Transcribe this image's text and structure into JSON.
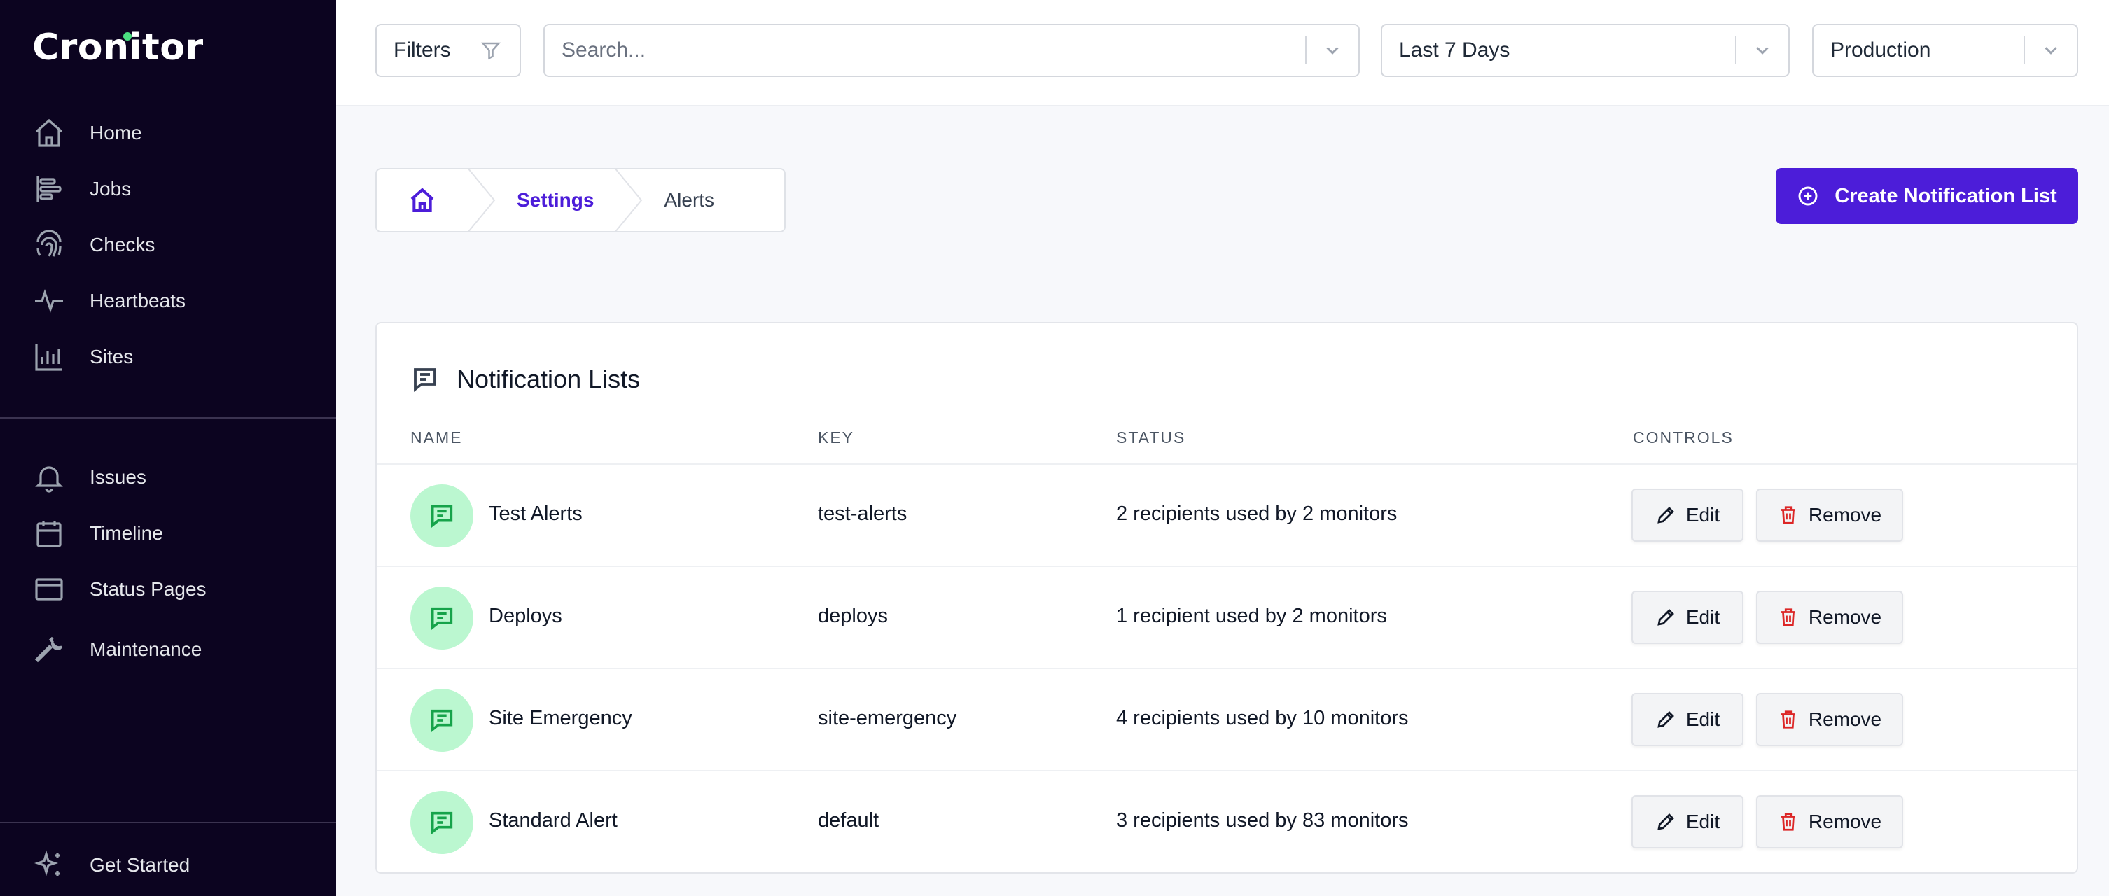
{
  "brand": {
    "name": "Cronitor",
    "accent": "#4c1dd9",
    "sidebar_bg": "#0c0420"
  },
  "sidebar": {
    "primary": [
      {
        "label": "Home",
        "icon": "home-icon"
      },
      {
        "label": "Jobs",
        "icon": "jobs-icon"
      },
      {
        "label": "Checks",
        "icon": "fingerprint-icon"
      },
      {
        "label": "Heartbeats",
        "icon": "pulse-icon"
      },
      {
        "label": "Sites",
        "icon": "bar-chart-icon"
      }
    ],
    "secondary": [
      {
        "label": "Issues",
        "icon": "bell-icon"
      },
      {
        "label": "Timeline",
        "icon": "calendar-icon"
      },
      {
        "label": "Status Pages",
        "icon": "browser-window-icon"
      },
      {
        "label": "Maintenance",
        "icon": "wrench-icon"
      }
    ],
    "footer": {
      "label": "Get Started",
      "icon": "sparkles-icon"
    }
  },
  "topbar": {
    "filters_label": "Filters",
    "search_placeholder": "Search...",
    "time_range": "Last 7 Days",
    "environment": "Production"
  },
  "breadcrumb": {
    "settings": "Settings",
    "current": "Alerts"
  },
  "actions": {
    "create_label": "Create Notification List"
  },
  "card": {
    "title": "Notification Lists",
    "columns": {
      "name": "NAME",
      "key": "KEY",
      "status": "STATUS",
      "controls": "CONTROLS"
    },
    "edit_label": "Edit",
    "remove_label": "Remove",
    "rows": [
      {
        "name": "Test Alerts",
        "key": "test-alerts",
        "status": "2 recipients used by 2 monitors"
      },
      {
        "name": "Deploys",
        "key": "deploys",
        "status": "1 recipient used by 2 monitors"
      },
      {
        "name": "Site Emergency",
        "key": "site-emergency",
        "status": "4 recipients used by 10 monitors"
      },
      {
        "name": "Standard Alert",
        "key": "default",
        "status": "3 recipients used by 83 monitors"
      }
    ]
  }
}
